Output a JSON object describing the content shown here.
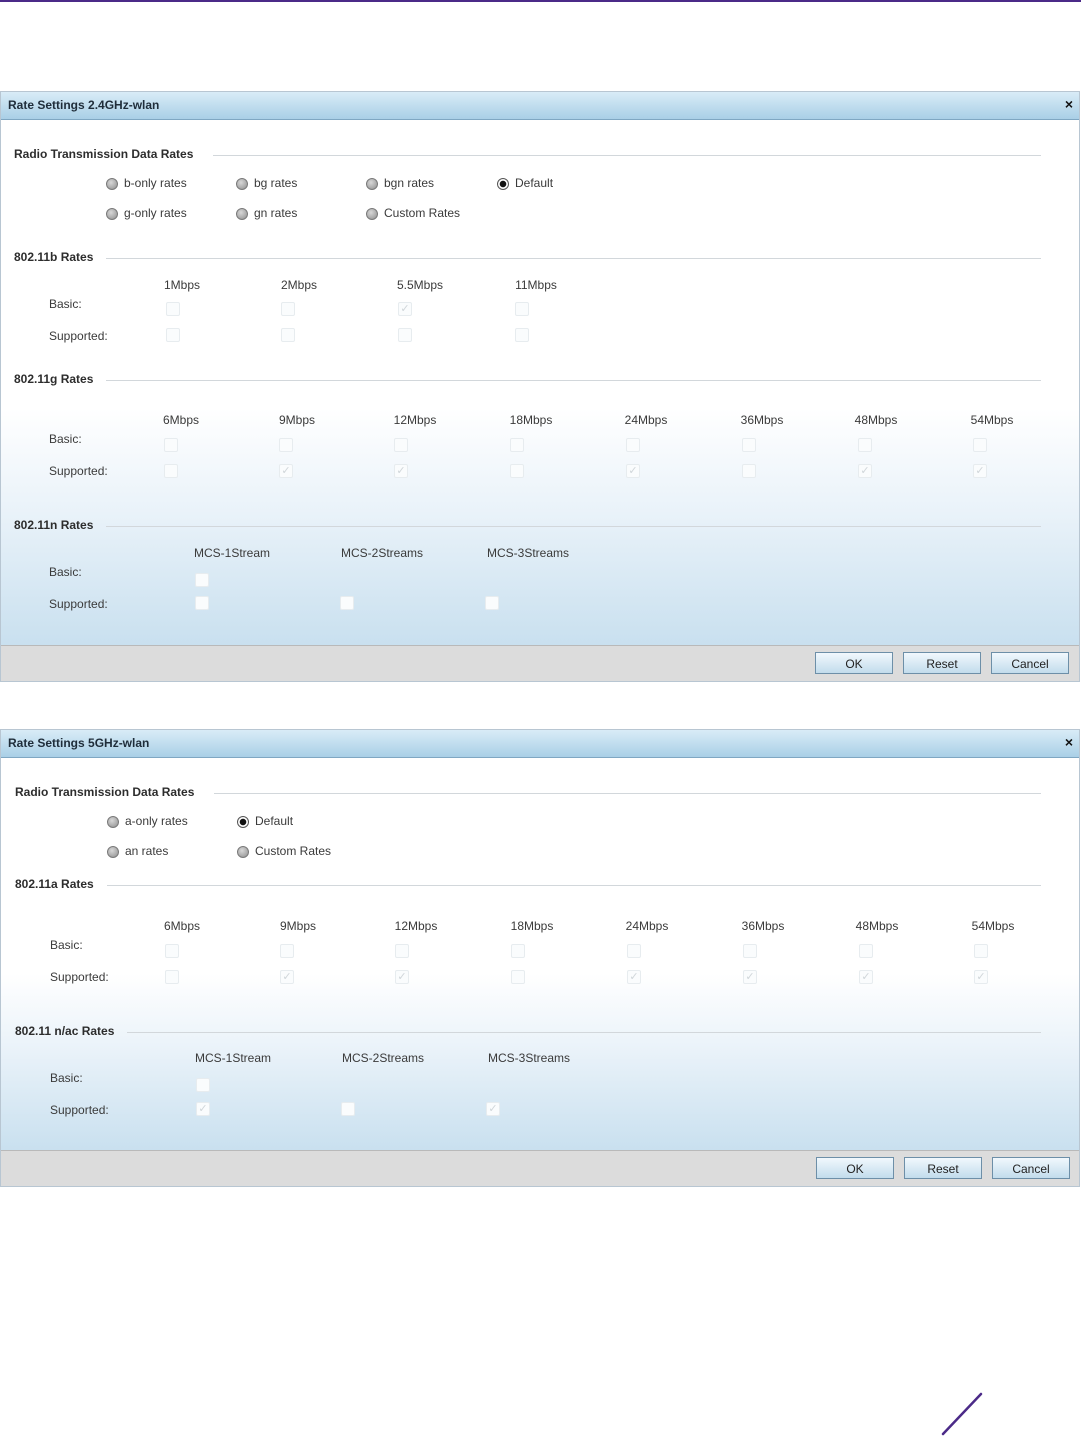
{
  "dialog1": {
    "title": "Rate Settings 2.4GHz-wlan",
    "radio_section": "Radio Transmission Data Rates",
    "radios": [
      {
        "label": "b-only rates",
        "selected": false
      },
      {
        "label": "bg rates",
        "selected": false
      },
      {
        "label": "bgn rates",
        "selected": false
      },
      {
        "label": "Default",
        "selected": true
      },
      {
        "label": "g-only rates",
        "selected": false
      },
      {
        "label": "gn rates",
        "selected": false
      },
      {
        "label": "Custom Rates",
        "selected": false
      }
    ],
    "b_section": "802.11b Rates",
    "b_cols": [
      "1Mbps",
      "2Mbps",
      "5.5Mbps",
      "11Mbps"
    ],
    "g_section": "802.11g Rates",
    "g_cols": [
      "6Mbps",
      "9Mbps",
      "12Mbps",
      "18Mbps",
      "24Mbps",
      "36Mbps",
      "48Mbps",
      "54Mbps"
    ],
    "n_section": "802.11n Rates",
    "n_cols": [
      "MCS-1Stream",
      "MCS-2Streams",
      "MCS-3Streams"
    ],
    "basic_label": "Basic:",
    "supported_label": "Supported:",
    "ok": "OK",
    "reset": "Reset",
    "cancel": "Cancel"
  },
  "dialog2": {
    "title": "Rate Settings 5GHz-wlan",
    "radio_section": "Radio Transmission Data Rates",
    "radios": [
      {
        "label": "a-only rates",
        "selected": false
      },
      {
        "label": "Default",
        "selected": true
      },
      {
        "label": "an rates",
        "selected": false
      },
      {
        "label": "Custom Rates",
        "selected": false
      }
    ],
    "a_section": "802.11a Rates",
    "a_cols": [
      "6Mbps",
      "9Mbps",
      "12Mbps",
      "18Mbps",
      "24Mbps",
      "36Mbps",
      "48Mbps",
      "54Mbps"
    ],
    "nac_section": "802.11 n/ac Rates",
    "nac_cols": [
      "MCS-1Stream",
      "MCS-2Streams",
      "MCS-3Streams"
    ],
    "basic_label": "Basic:",
    "supported_label": "Supported:",
    "ok": "OK",
    "reset": "Reset",
    "cancel": "Cancel"
  },
  "close_glyph": "×"
}
